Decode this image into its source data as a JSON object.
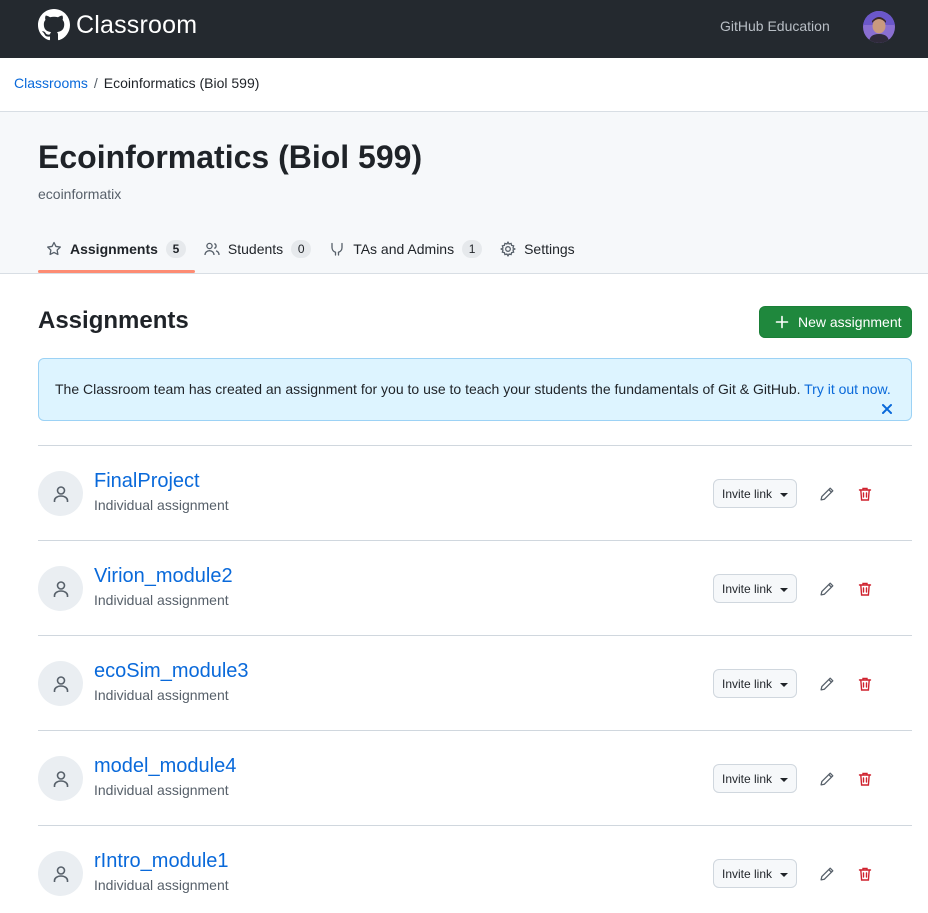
{
  "header": {
    "app_name": "Classroom",
    "education_link": "GitHub Education"
  },
  "breadcrumb": {
    "root": "Classrooms",
    "separator": "/",
    "current": "Ecoinformatics (Biol 599)"
  },
  "classroom": {
    "title": "Ecoinformatics (Biol 599)",
    "organization": "ecoinformatix"
  },
  "tabs": [
    {
      "label": "Assignments",
      "count": "5",
      "icon": "star-icon",
      "selected": true
    },
    {
      "label": "Students",
      "count": "0",
      "icon": "people-icon",
      "selected": false
    },
    {
      "label": "TAs and Admins",
      "count": "1",
      "icon": "mortar-board-icon",
      "selected": false
    },
    {
      "label": "Settings",
      "icon": "gear-icon",
      "selected": false
    }
  ],
  "assignments_section": {
    "title": "Assignments",
    "new_button": "New assignment"
  },
  "flash": {
    "message": "The Classroom team has created an assignment for you to use to teach your students the fundamentals of Git & GitHub. ",
    "link": "Try it out now."
  },
  "assignments": [
    {
      "name": "FinalProject",
      "type": "Individual assignment",
      "invite_label": "Invite link"
    },
    {
      "name": "Virion_module2",
      "type": "Individual assignment",
      "invite_label": "Invite link"
    },
    {
      "name": "ecoSim_module3",
      "type": "Individual assignment",
      "invite_label": "Invite link"
    },
    {
      "name": "model_module4",
      "type": "Individual assignment",
      "invite_label": "Invite link"
    },
    {
      "name": "rIntro_module1",
      "type": "Individual assignment",
      "invite_label": "Invite link"
    }
  ],
  "colors": {
    "header_bg": "#24292f",
    "link": "#0969da",
    "primary_button": "#1f883d",
    "danger": "#cf222e",
    "tab_underline": "#fd8c73",
    "flash_bg": "#ddf4ff"
  }
}
